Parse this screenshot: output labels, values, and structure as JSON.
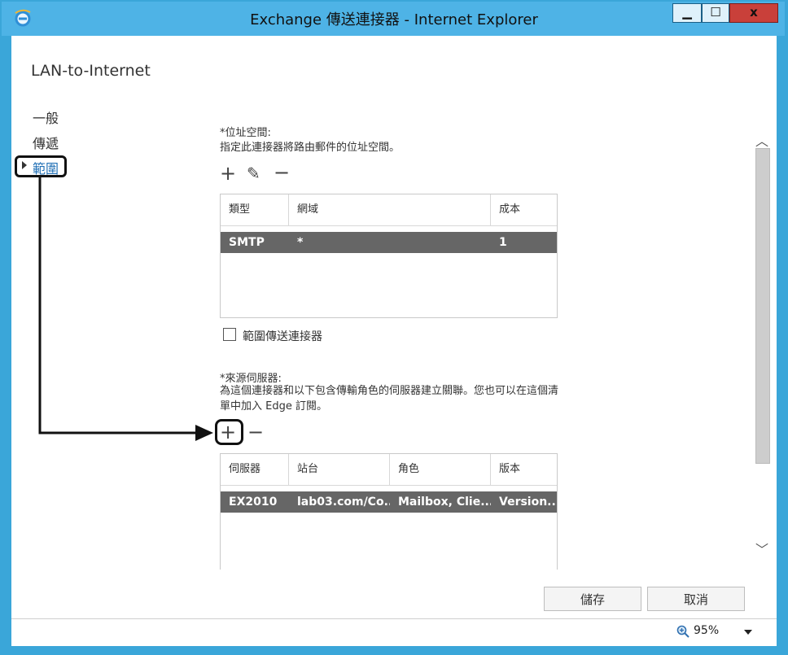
{
  "window": {
    "title": "Exchange 傳送連接器 - Internet Explorer",
    "buttons": {
      "minimize": "▁",
      "maximize": "☐",
      "close": "x"
    }
  },
  "page": {
    "title": "LAN-to-Internet"
  },
  "nav": {
    "items": [
      {
        "label": "一般"
      },
      {
        "label": "傳遞"
      },
      {
        "label": "範圍",
        "selected": true
      }
    ]
  },
  "address_space": {
    "label": "*位址空間:",
    "description": "指定此連接器將路由郵件的位址空間。",
    "toolbar": {
      "add": "+",
      "edit": "✎",
      "remove": "−"
    },
    "columns": [
      "類型",
      "網域",
      "成本"
    ],
    "rows": [
      {
        "type": "SMTP",
        "domain": "*",
        "cost": "1"
      }
    ]
  },
  "scoped_connector": {
    "label": "範圍傳送連接器",
    "checked": false
  },
  "source_servers": {
    "label": "*來源伺服器:",
    "description": "為這個連接器和以下包含傳輸角色的伺服器建立關聯。您也可以在這個清單中加入 Edge 訂閱。",
    "toolbar": {
      "add": "+",
      "remove": "−"
    },
    "columns": [
      "伺服器",
      "站台",
      "角色",
      "版本"
    ],
    "rows": [
      {
        "server": "EX2010",
        "site": "lab03.com/Co...",
        "role": "Mailbox, Clie...",
        "version": "Version..."
      }
    ]
  },
  "actions": {
    "save": "儲存",
    "cancel": "取消"
  },
  "status": {
    "zoom": "95%"
  },
  "colors": {
    "accent": "#4eb3e6",
    "selected_row": "#666666",
    "link": "#1f6fb5",
    "close": "#c9403a"
  }
}
